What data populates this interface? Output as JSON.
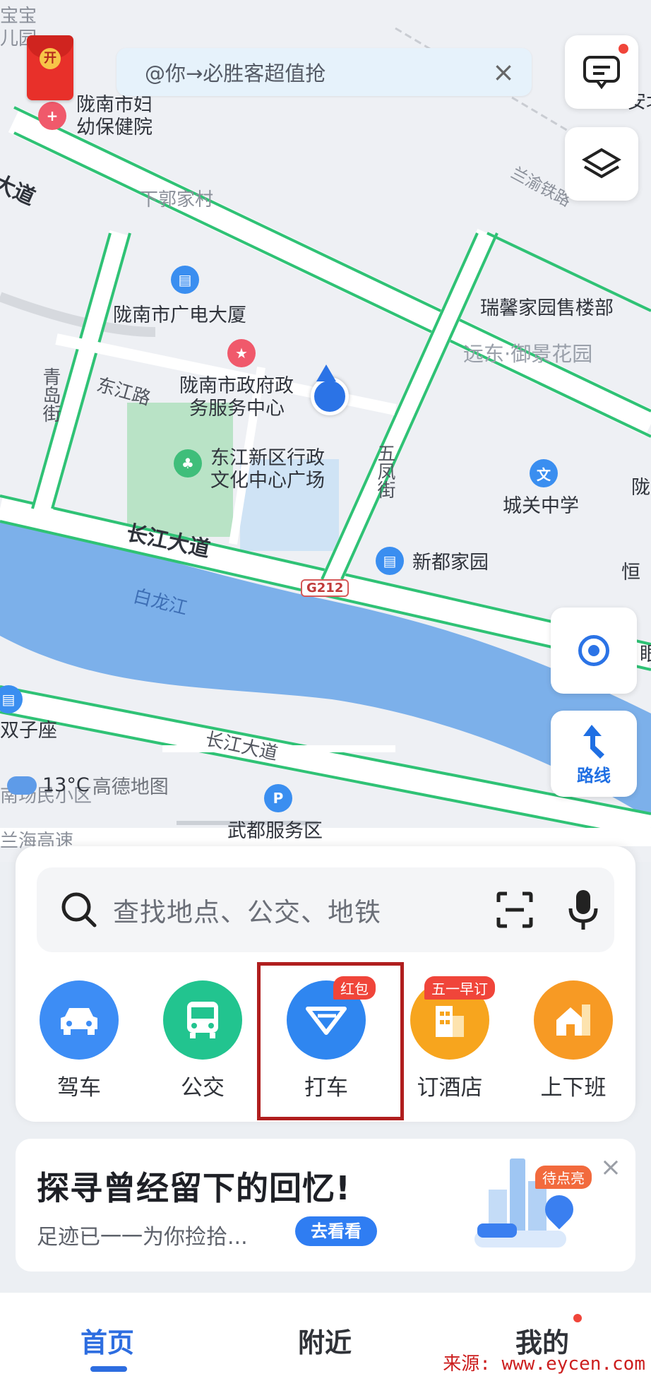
{
  "map": {
    "labels": {
      "baobao_top": "宝宝",
      "baobao_bottom": "儿园",
      "hospital_line1": "陇南市妇",
      "hospital_line2": "幼保健院",
      "village": "下郭家村",
      "railway": "兰渝铁路",
      "radio_building": "陇南市广电大厦",
      "ruixin": "瑞馨家园售楼部",
      "yuandong": "远东·御景花园",
      "gov_line1": "陇南市政府政",
      "gov_line2": "务服务中心",
      "plaza_line1": "东江新区行政",
      "plaza_line2": "文化中心广场",
      "chengguan": "城关中学",
      "xindu": "新都家园",
      "shuangzi": "双子座",
      "wudu_service": "武都服务区",
      "anbei": "安北",
      "long_right": "陇",
      "heng_right": "恒",
      "yan_right": "眼",
      "minxiaoqu": "南场民小区",
      "edge_road": "兰海高速",
      "road_left_edge": "大道"
    },
    "roads": {
      "dongjiang": "东江路",
      "qingdao": "青岛街",
      "wufeng": "五凤街",
      "changjiang_main": "长江大道",
      "changjiang_lower": "长江大道",
      "bailong": "白龙江",
      "g212": "G212"
    },
    "weather": {
      "temp": "13°C",
      "brand": "高德地图"
    }
  },
  "top_banner": {
    "text": "@你→必胜客超值抢",
    "close": "×"
  },
  "hongbao": {
    "label": "开"
  },
  "right_buttons": {
    "route_label": "路线"
  },
  "search": {
    "placeholder": "查找地点、公交、地铁"
  },
  "tools": [
    {
      "label": "驾车",
      "color": "#3d8df5",
      "badge": ""
    },
    {
      "label": "公交",
      "color": "#22c48f",
      "badge": ""
    },
    {
      "label": "打车",
      "color": "#2f86f0",
      "badge": "红包"
    },
    {
      "label": "订酒店",
      "color": "#f7a51e",
      "badge": "五一早订"
    },
    {
      "label": "上下班",
      "color": "#f79a24",
      "badge": ""
    }
  ],
  "memory_card": {
    "title": "探寻曾经留下的回忆!",
    "subtitle": "足迹已一一为你捡拾...",
    "button": "去看看",
    "badge": "待点亮",
    "close": "×"
  },
  "bottom_nav": [
    {
      "label": "首页",
      "active": true
    },
    {
      "label": "附近",
      "active": false
    },
    {
      "label": "我的",
      "active": false
    }
  ],
  "watermark": "来源: www.eycen.com"
}
